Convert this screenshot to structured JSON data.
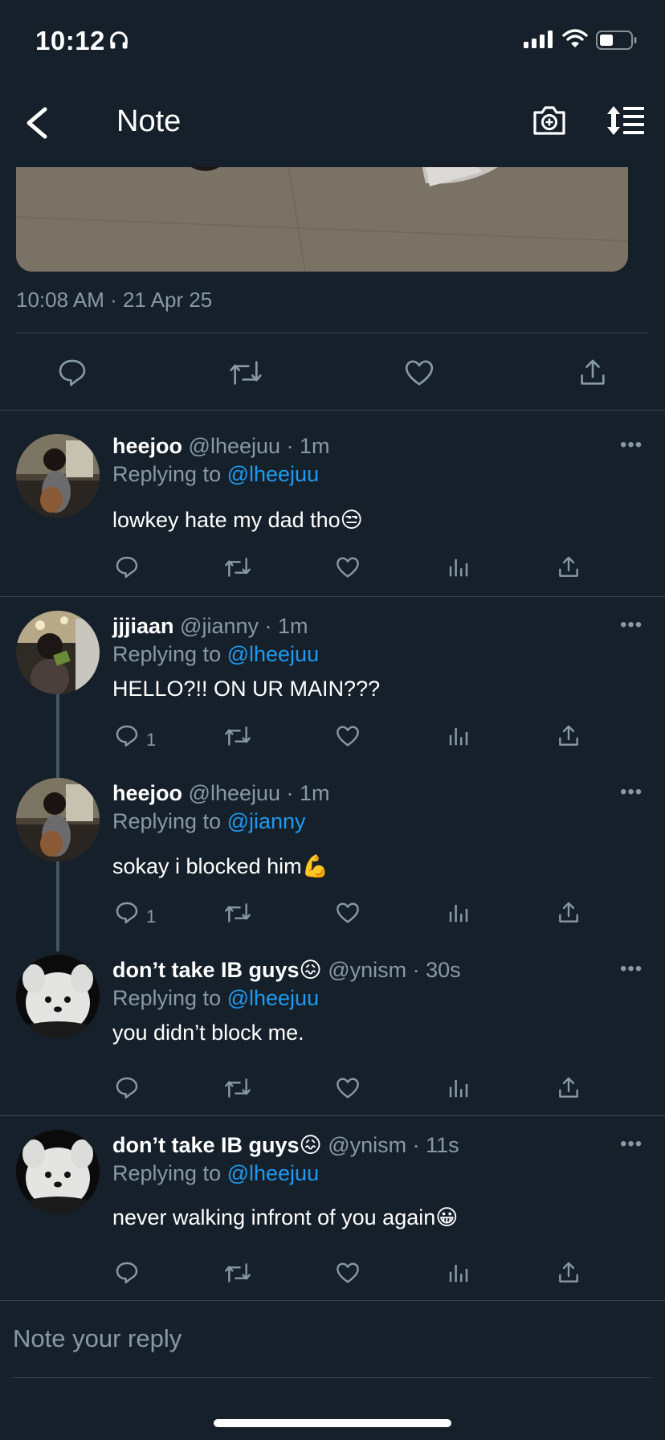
{
  "status_bar": {
    "time": "10:12"
  },
  "header": {
    "title": "Note"
  },
  "tweet": {
    "timestamp": "10:08 AM · 21 Apr 25"
  },
  "colors": {
    "background": "#15202b",
    "accent": "#1d9bf0",
    "muted": "#8899a6",
    "divider": "#38444d"
  },
  "replies": [
    {
      "name": "heejoo",
      "handle": "@lheejuu · 1m",
      "replying_prefix": "Replying to ",
      "replying_to": "@lheejuu",
      "text": "lowkey hate my dad tho😒",
      "reply_count": ""
    },
    {
      "name": "jjjiaan",
      "handle": "@jianny · 1m",
      "replying_prefix": "Replying to ",
      "replying_to": "@lheejuu",
      "text": "HELLO?!! ON UR MAIN???",
      "reply_count": "1"
    },
    {
      "name": "heejoo",
      "handle": "@lheejuu · 1m",
      "replying_prefix": "Replying to ",
      "replying_to": "@jianny",
      "text": "sokay i blocked him💪",
      "reply_count": "1"
    },
    {
      "name": "don’t take IB guys😖",
      "handle": "@ynism · 30s",
      "replying_prefix": "Replying to ",
      "replying_to": "@lheejuu",
      "text": "you didn’t block me.",
      "reply_count": ""
    },
    {
      "name": "don’t take IB guys😖",
      "handle": "@ynism · 11s",
      "replying_prefix": "Replying to ",
      "replying_to": "@lheejuu",
      "text": "never walking infront of you again😀",
      "reply_count": ""
    }
  ],
  "more_label": "•••",
  "composer": {
    "placeholder": "Note your reply"
  }
}
